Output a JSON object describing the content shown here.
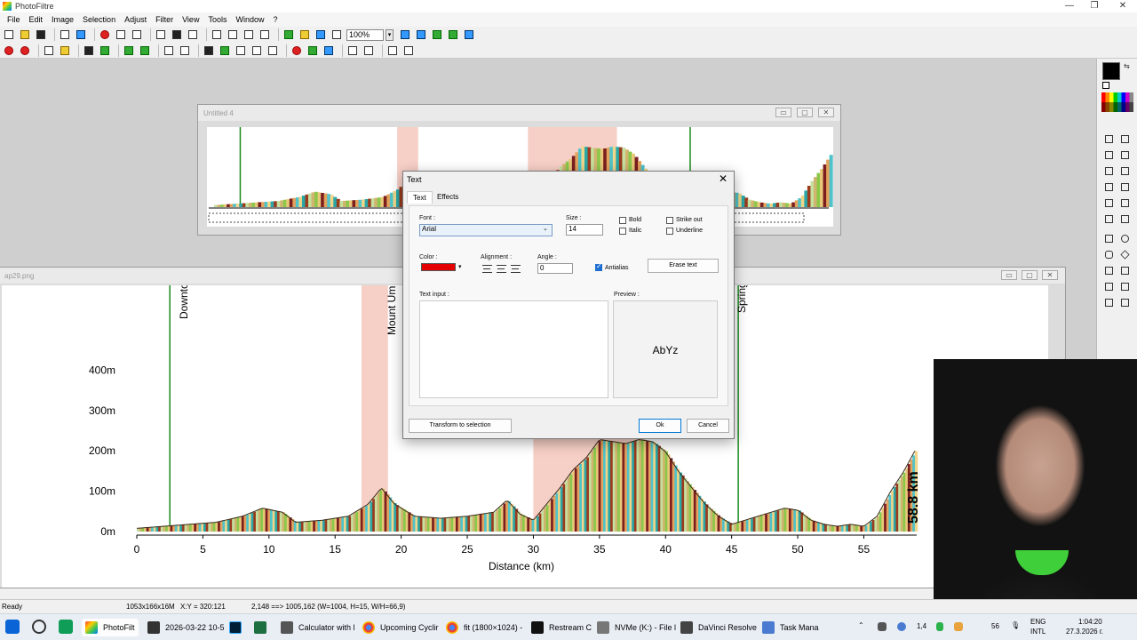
{
  "app": {
    "title": "PhotoFiltre"
  },
  "window_controls": {
    "minimize": "—",
    "maximize": "❐",
    "close": "✕"
  },
  "menu": [
    "File",
    "Edit",
    "Image",
    "Selection",
    "Adjust",
    "Filter",
    "View",
    "Tools",
    "Window",
    "?"
  ],
  "toolbar": {
    "zoom": "100%",
    "zoom_arrow": "▾"
  },
  "doc_top": {
    "title": "Untitled 4",
    "min": "▭",
    "max": "▢",
    "close": "✕"
  },
  "doc_main": {
    "title": "ap29.png",
    "min": "▭",
    "max": "▢",
    "close": "✕",
    "labels": {
      "downtown": "Downto",
      "mount": "Mount Um",
      "spring": "Spring"
    },
    "total_distance": "58.8 km"
  },
  "chart_data": {
    "type": "area",
    "xlabel": "Distance (km)",
    "ylabel": "",
    "x_ticks": [
      "0",
      "5",
      "10",
      "15",
      "20",
      "25",
      "30",
      "35",
      "40",
      "45",
      "50",
      "55"
    ],
    "y_ticks": [
      "0m",
      "100m",
      "200m",
      "300m",
      "400m"
    ],
    "xlim": [
      0,
      60
    ],
    "ylim": [
      0,
      450
    ],
    "series": [
      {
        "x": [
          0,
          2,
          4,
          6,
          8,
          9.5,
          11,
          12,
          14,
          16,
          17.5,
          18.5,
          19.5,
          21,
          23,
          25,
          27,
          28,
          29,
          30,
          31,
          32,
          33,
          34,
          35,
          36,
          37,
          38,
          39,
          40,
          41,
          42,
          43,
          44,
          45,
          46,
          47,
          48,
          49,
          50,
          51,
          52,
          53,
          54,
          55,
          56,
          57,
          58,
          59
        ],
        "y": [
          0,
          5,
          10,
          15,
          30,
          50,
          40,
          15,
          20,
          30,
          60,
          100,
          60,
          30,
          25,
          30,
          40,
          70,
          35,
          20,
          60,
          100,
          145,
          175,
          220,
          215,
          210,
          220,
          215,
          190,
          140,
          100,
          60,
          30,
          10,
          20,
          30,
          40,
          50,
          45,
          20,
          10,
          5,
          10,
          5,
          30,
          90,
          140,
          200
        ]
      }
    ],
    "grid": false
  },
  "dialog": {
    "title": "Text",
    "close": "✕",
    "tabs": [
      "Text",
      "Effects"
    ],
    "font_label": "Font :",
    "font_value": "Arial",
    "size_label": "Size :",
    "size_value": "14",
    "bold": "Bold",
    "italic": "Italic",
    "strike": "Strike out",
    "underline": "Underline",
    "color_label": "Color :",
    "alignment_label": "Alignment :",
    "angle_label": "Angle :",
    "angle_value": "0",
    "antialias": "Antialias",
    "erase": "Erase text",
    "text_input_label": "Text input :",
    "preview_label": "Preview :",
    "preview_text": "AbYz",
    "transform": "Transform to selection",
    "ok": "Ok",
    "cancel": "Cancel",
    "color_hex": "#e30000"
  },
  "status": {
    "ready": "Ready",
    "size": "1053x166x16M",
    "xy": "X:Y = 320:121",
    "sel": "2,148 ==> 1005,162 (W=1004, H=15, W/H=66,9)"
  },
  "taskbar": {
    "apps": [
      {
        "label": "PhotoFilt"
      },
      {
        "label": "2026-03-22 10-5"
      },
      {
        "label": ""
      },
      {
        "label": ""
      },
      {
        "label": "Calculator with l"
      },
      {
        "label": "Upcoming Cyclir"
      },
      {
        "label": "fit (1800×1024) -"
      },
      {
        "label": "Restream C"
      },
      {
        "label": "NVMe (K:) - File l"
      },
      {
        "label": "DaVinci Resolve"
      },
      {
        "label": "Task Mana"
      }
    ],
    "tray_nums": [
      "1,4",
      "56"
    ],
    "lang": "ENG",
    "layout": "INTL",
    "time": "1:04:20",
    "date": "27.3.2026 г."
  }
}
